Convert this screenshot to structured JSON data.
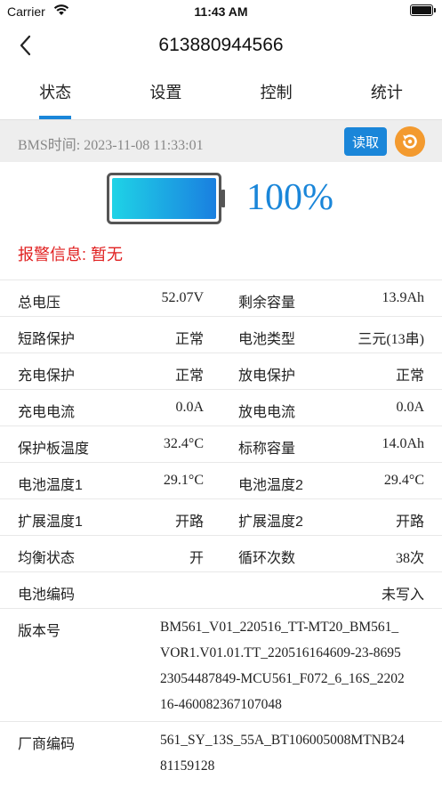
{
  "status_bar": {
    "carrier": "Carrier",
    "time": "11:43 AM"
  },
  "nav": {
    "title": "613880944566"
  },
  "tabs": [
    {
      "label": "状态",
      "active": true
    },
    {
      "label": "设置",
      "active": false
    },
    {
      "label": "控制",
      "active": false
    },
    {
      "label": "统计",
      "active": false
    }
  ],
  "info": {
    "bms_time": "BMS时间: 2023-11-08 11:33:01",
    "read_label": "读取"
  },
  "battery": {
    "percent_text": "100%",
    "level": 1.0
  },
  "alarm": {
    "text": "报警信息:  暂无"
  },
  "rows": [
    {
      "l1": "总电压",
      "v1": "52.07V",
      "l2": "剩余容量",
      "v2": "13.9Ah"
    },
    {
      "l1": "短路保护",
      "v1": "正常",
      "l2": "电池类型",
      "v2": "三元(13串)"
    },
    {
      "l1": "充电保护",
      "v1": "正常",
      "l2": "放电保护",
      "v2": "正常"
    },
    {
      "l1": "充电电流",
      "v1": "0.0A",
      "l2": "放电电流",
      "v2": "0.0A"
    },
    {
      "l1": "保护板温度",
      "v1": "32.4°C",
      "l2": "标称容量",
      "v2": "14.0Ah"
    },
    {
      "l1": "电池温度1",
      "v1": "29.1°C",
      "l2": "电池温度2",
      "v2": "29.4°C"
    },
    {
      "l1": "扩展温度1",
      "v1": "开路",
      "l2": "扩展温度2",
      "v2": "开路"
    },
    {
      "l1": "均衡状态",
      "v1": "开",
      "l2": "循环次数",
      "v2": "38次"
    }
  ],
  "battery_code": {
    "label": "电池编码",
    "value": "未写入"
  },
  "version": {
    "label": "版本号",
    "lines": [
      "BM561_V01_220516_TT-MT20_BM561_",
      "VOR1.V01.01.TT_220516164609-23-8695",
      "23054487849-MCU561_F072_6_16S_2202",
      "16-460082367107048"
    ]
  },
  "vendor": {
    "label": "厂商编码",
    "lines": [
      "561_SY_13S_55A_BT106005008MTNB24",
      "81159128"
    ]
  },
  "colors": {
    "accent": "#1a86d9",
    "alarm": "#e02020",
    "refresh": "#f39a2f"
  }
}
